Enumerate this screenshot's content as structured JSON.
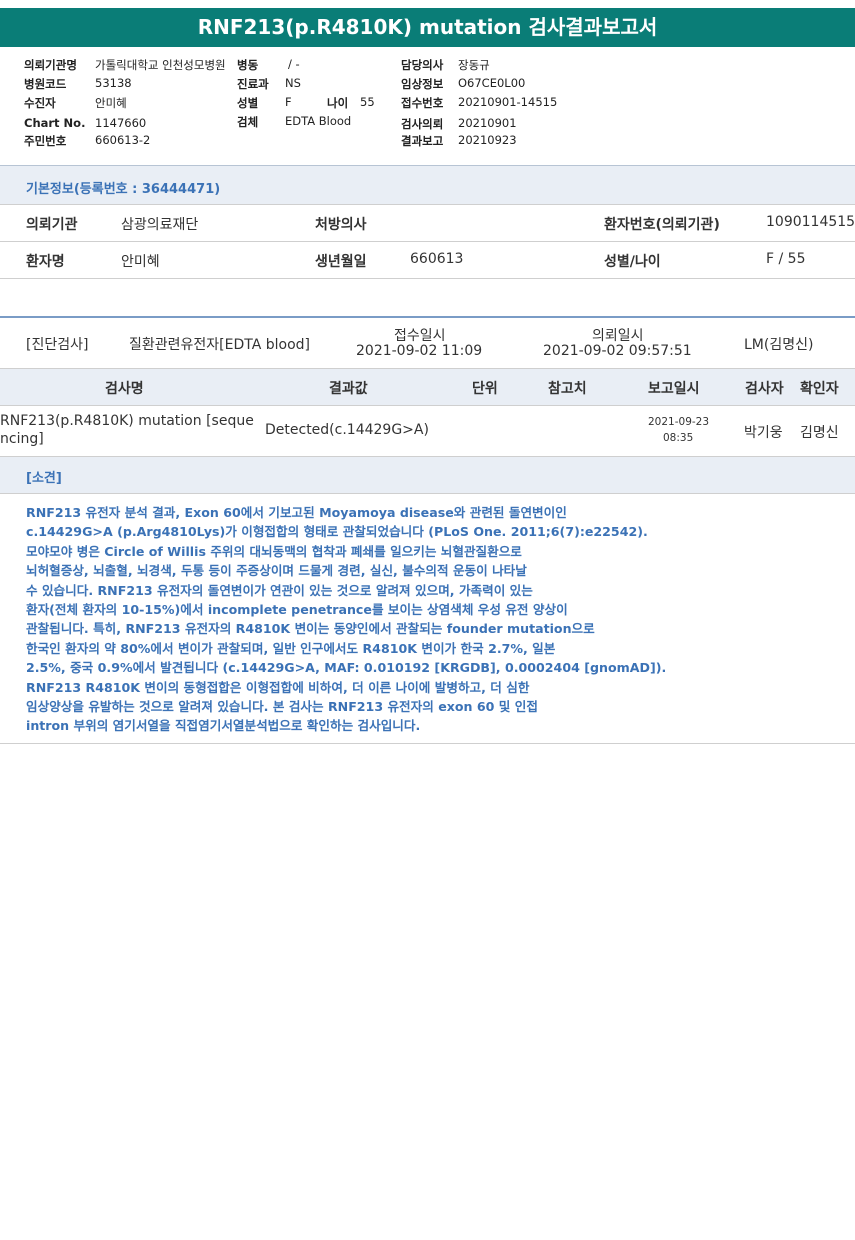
{
  "title": "RNF213(p.R4810K) mutation 검사결과보고서",
  "header": {
    "left": [
      {
        "label": "의뢰기관명",
        "value": "가톨릭대학교 인천성모병원"
      },
      {
        "label": "병원코드",
        "value": "53138"
      },
      {
        "label": "수진자",
        "value": "안미혜"
      },
      {
        "label": "Chart No.",
        "value": "1147660"
      },
      {
        "label": "주민번호",
        "value": "660613-2"
      }
    ],
    "mid": [
      {
        "label": "병동",
        "value": "/ -"
      },
      {
        "label": "진료과",
        "value": "NS"
      },
      {
        "label": "성별",
        "value": "F"
      },
      {
        "label": "검체",
        "value": "EDTA Blood"
      }
    ],
    "age_label": "나이",
    "age_value": "55",
    "right": [
      {
        "label": "담당의사",
        "value": "장동규"
      },
      {
        "label": "임상정보",
        "value": "O67CE0L00"
      },
      {
        "label": "접수번호",
        "value": "20210901-14515"
      },
      {
        "label": "검사의뢰",
        "value": "20210901"
      },
      {
        "label": "결과보고",
        "value": "20210923"
      }
    ]
  },
  "basic_info": {
    "section_title": "기본정보(등록번호 : 36444471)",
    "row1": {
      "l1": "의뢰기관",
      "v1": "삼광의료재단",
      "l2": "처방의사",
      "v2": "",
      "l3": "환자번호(의뢰기관)",
      "v3": "1090114515"
    },
    "row2": {
      "l1": "환자명",
      "v1": "안미혜",
      "l2": "생년월일",
      "v2": "660613",
      "l3": "성별/나이",
      "v3": "F / 55"
    }
  },
  "order": {
    "category": "[진단검사]",
    "name": "질환관련유전자[EDTA blood]",
    "received_label": "접수일시",
    "received_value": "2021-09-02  11:09",
    "requested_label": "의뢰일시",
    "requested_value": "2021-09-02  09:57:51",
    "lab": "LM(김명신)"
  },
  "results_table": {
    "headers": [
      "검사명",
      "결과값",
      "단위",
      "참고치",
      "보고일시",
      "검사자",
      "확인자"
    ],
    "row": {
      "name_line1": "RNF213(p.R4810K) mutation [seque",
      "name_line2": "ncing]",
      "result": "Detected(c.14429G>A)",
      "unit": "",
      "reference": "",
      "report_date": "2021-09-23",
      "report_time": "08:35",
      "tester": "박기웅",
      "confirmer": "김명신"
    }
  },
  "opinion": {
    "title": "[소견]",
    "lines": [
      "RNF213 유전자 분석 결과, Exon 60에서 기보고된 Moyamoya disease와 관련된 돌연변이인",
      "c.14429G>A (p.Arg4810Lys)가 이형접합의 형태로 관찰되었습니다 (PLoS One. 2011;6(7):e22542).",
      "모야모야 병은 Circle of Willis 주위의 대뇌동맥의 협착과 폐쇄를 일으키는 뇌혈관질환으로",
      "뇌허혈증상, 뇌출혈, 뇌경색, 두통 등이 주증상이며 드물게 경련, 실신, 불수의적 운동이 나타날",
      "수 있습니다. RNF213 유전자의 돌연변이가 연관이 있는 것으로 알려져 있으며, 가족력이 있는",
      "환자(전체 환자의 10-15%)에서 incomplete penetrance를 보이는 상염색체 우성 유전 양상이",
      "관찰됩니다. 특히, RNF213 유전자의 R4810K 변이는 동양인에서 관찰되는 founder mutation으로",
      "한국인 환자의 약 80%에서 변이가 관찰되며, 일반 인구에서도 R4810K 변이가 한국 2.7%, 일본",
      "2.5%, 중국 0.9%에서 발견됩니다 (c.14429G>A, MAF: 0.010192 [KRGDB], 0.0002404 [gnomAD]).",
      "RNF213 R4810K 변이의 동형접합은 이형접합에 비하여, 더 이른 나이에 발병하고, 더 심한",
      "임상양상을 유발하는 것으로 알려져 있습니다. 본 검사는 RNF213 유전자의 exon 60 및 인접",
      "intron 부위의 염기서열을 직접염기서열분석법으로 확인하는 검사입니다."
    ]
  }
}
